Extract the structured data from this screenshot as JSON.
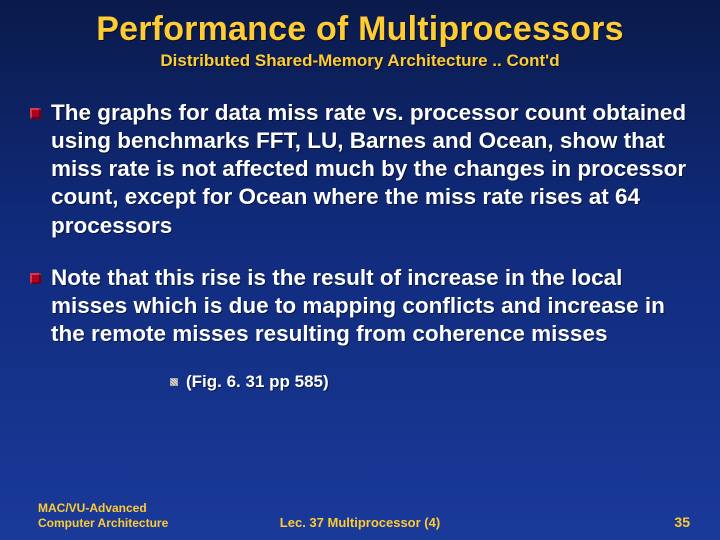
{
  "title": "Performance of Multiprocessors",
  "subtitle": "Distributed Shared-Memory Architecture .. Cont'd",
  "bullets": [
    "The graphs for data miss rate vs. processor count obtained using benchmarks FFT, LU, Barnes and Ocean, show that miss rate is not affected much by the changes in processor count, except for Ocean where the miss rate rises at 64 processors",
    "Note that this rise is the result of increase in the local misses which is due to mapping conflicts and increase in the remote misses resulting from coherence misses"
  ],
  "subbullet": "(Fig. 6. 31 pp 585)",
  "footer": {
    "left": "MAC/VU-Advanced Computer Architecture",
    "center": "Lec. 37 Multiprocessor (4)",
    "right": "35"
  }
}
